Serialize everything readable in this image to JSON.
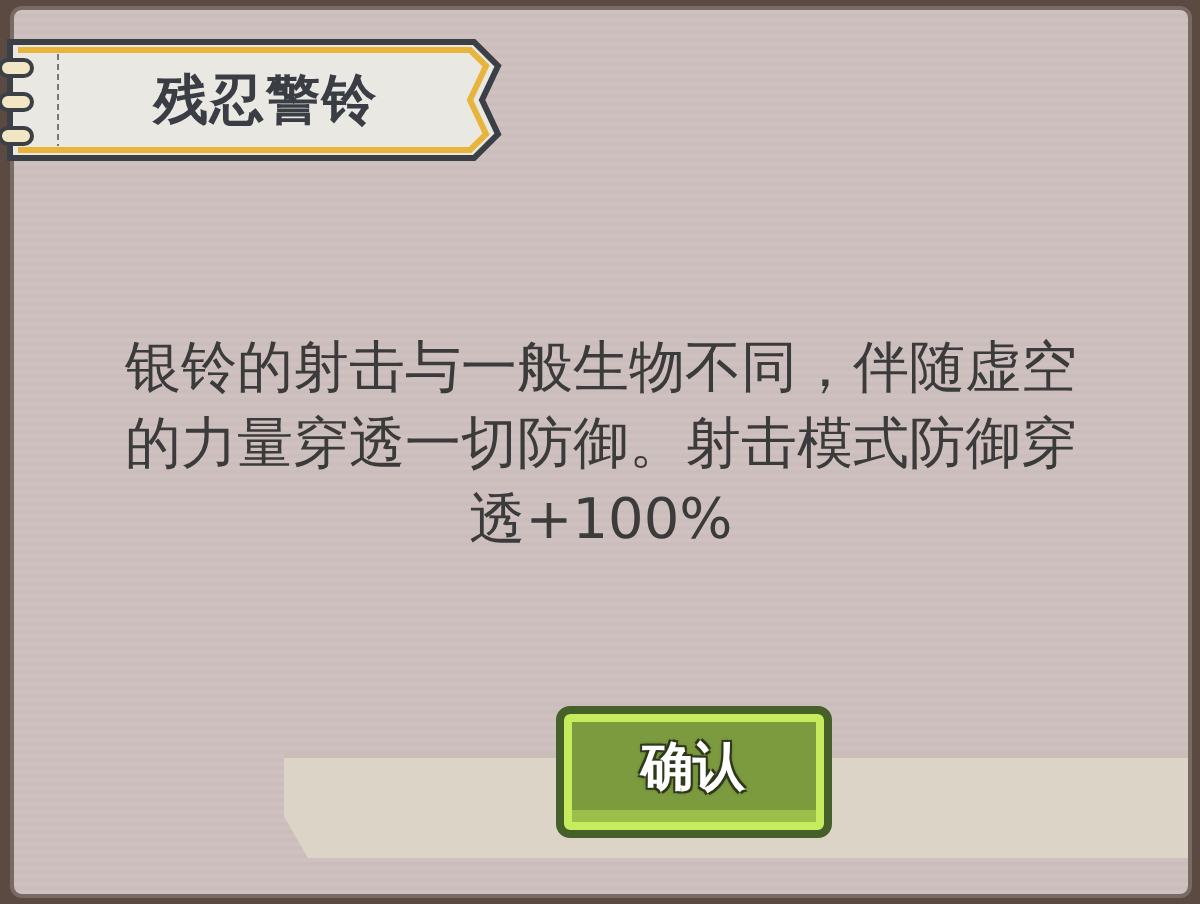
{
  "dialog": {
    "title": "残忍警铃",
    "description": "银铃的射击与一般生物不同，伴随虚空的力量穿透一切防御。射击模式防御穿透+100%",
    "buttons": [
      {
        "label": "确认",
        "kind": "confirm"
      }
    ]
  }
}
